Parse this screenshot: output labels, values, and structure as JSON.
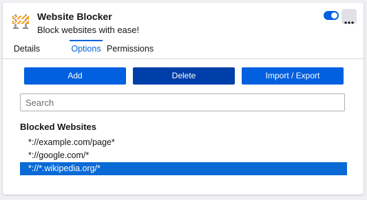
{
  "addon": {
    "name": "Website Blocker",
    "description": "Block websites with ease!",
    "enabled": true,
    "icon": "barrier-icon"
  },
  "tabs": [
    {
      "label": "Details",
      "active": false
    },
    {
      "label": "Options",
      "active": true
    },
    {
      "label": "Permissions",
      "active": false
    }
  ],
  "buttons": {
    "add": "Add",
    "delete": "Delete",
    "import_export": "Import / Export"
  },
  "search": {
    "placeholder": "Search",
    "value": ""
  },
  "blocked": {
    "title": "Blocked Websites",
    "items": [
      {
        "pattern": "*://example.com/page*",
        "selected": false
      },
      {
        "pattern": "*://google.com/*",
        "selected": false
      },
      {
        "pattern": "*://*.wikipedia.org/*",
        "selected": true
      }
    ]
  },
  "colors": {
    "accent": "#0061e0",
    "add_button": "#0060df",
    "delete_button": "#003eaa",
    "selection": "#0a6ad6"
  }
}
